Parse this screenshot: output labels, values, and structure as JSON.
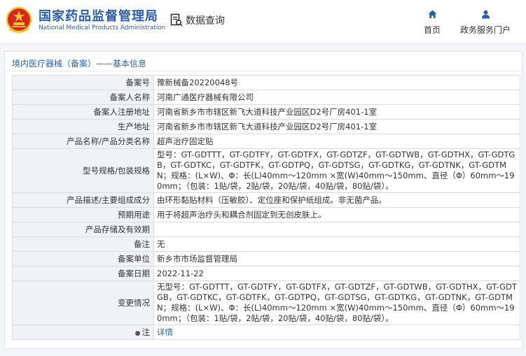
{
  "header": {
    "title_cn": "国家药品监督管理局",
    "title_en": "National Medical Products Administration",
    "query_label": "数据查询",
    "nav": [
      {
        "label": "首页",
        "icon": "home-icon"
      },
      {
        "label": "政务服务门户",
        "icon": "user-icon"
      }
    ]
  },
  "breadcrumb": {
    "category": "境内医疗器械（备案）",
    "sep": "——",
    "page": "基本信息"
  },
  "colors": {
    "brand_blue": "#2a5fac",
    "emblem_red": "#d7261d",
    "emblem_gold": "#f3c431",
    "label_bg": "#f0f2f5"
  },
  "rows": [
    {
      "label": "备案号",
      "value": "豫新械备20220048号"
    },
    {
      "label": "备案人名称",
      "value": "河南广通医疗器械有限公司"
    },
    {
      "label": "备案人注册地址",
      "value": "河南省新乡市市辖区新飞大道科技产业园区D2号厂房401-1室"
    },
    {
      "label": "生产地址",
      "value": "河南省新乡市市辖区新飞大道科技产业园区D2号厂房401-1室"
    },
    {
      "label": "产品名称/产品分类名称",
      "value": "超声治疗固定贴"
    },
    {
      "label": "型号规格/包装规格",
      "value": "型号：GT-GDTTT，GT-GDTFY，GT-GDTFX，GT-GDTZF，GT-GDTWB，GT-GDTHX，GT-GDTGB，GT-GDTKC，GT-GDTFK，GT-GDTPQ，GT-GDTSG，GT-GDTKG，GT-GDTNK，GT-GDTMN；规格：(L×W)、Φ：长(L)40mm～120mm ×宽(W)40mm～150mm、直径（Φ）60mm～190mm；（包装：1贴/袋，2贴/袋，20贴/袋，40贴/袋，80贴/袋）。"
    },
    {
      "label": "产品描述/主要组成成分",
      "value": "由环形黏贴材料（压敏胶）、定位座和保护纸组成。非无菌产品。"
    },
    {
      "label": "预期用途",
      "value": "用于将超声治疗头和耦合剂固定到无创皮肤上。"
    },
    {
      "label": "产品存储及有效期",
      "value": ""
    },
    {
      "label": "备注",
      "value": "无"
    },
    {
      "label": "备案单位",
      "value": "新乡市市场监督管理局"
    },
    {
      "label": "备案日期",
      "value": "2022-11-22"
    },
    {
      "label": "变更情况",
      "value": "无型号：GT-GDTTT，GT-GDTFY，GT-GDTFX，GT-GDTZF，GT-GDTWB，GT-GDTHX，GT-GDTGB，GT-GDTKC，GT-GDTFK，GT-GDTPQ，GT-GDTSG，GT-GDTKG，GT-GDTNK，GT-GDTMN；规格：(L×W)、Φ：长(L)40mm～120mm ×宽(W)40mm～150mm、直径（Φ）60mm～190mm；（包装：1贴/袋，2贴/袋，20贴/袋，40贴/袋，80贴/袋）。"
    },
    {
      "label": "注",
      "value": "详情",
      "icon": "pin-icon"
    }
  ]
}
